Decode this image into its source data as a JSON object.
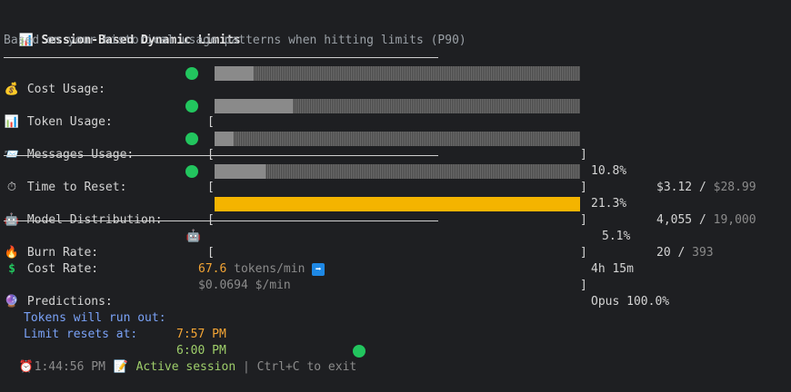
{
  "header": {
    "title_icon": "bar-chart-icon",
    "title": "Session-Based Dynamic Limits",
    "subtitle": "Based on your historical usage patterns when hitting limits (P90)"
  },
  "metrics": [
    {
      "icon": "money-bag-icon",
      "label": "Cost Usage:",
      "status": "green",
      "fill": 0.108,
      "percent": "10.8%",
      "value": "$3.12",
      "sep": " / ",
      "limit": "$28.99"
    },
    {
      "icon": "bar-chart-icon",
      "label": "Token Usage:",
      "status": "green",
      "fill": 0.213,
      "percent": "21.3%",
      "value": "4,055",
      "sep": " / ",
      "limit": "19,000"
    },
    {
      "icon": "inbox-icon",
      "label": "Messages Usage:",
      "status": "green",
      "fill": 0.051,
      "percent": "5.1%",
      "value": "20",
      "sep": " / ",
      "limit": "393"
    },
    {
      "icon": "stopwatch-icon",
      "label": "Time to Reset:",
      "status": "green",
      "fill": 0.14,
      "percent": "4h 15m",
      "value": "",
      "sep": "",
      "limit": ""
    }
  ],
  "distribution": {
    "icon": "robot-icon",
    "label": "Model Distribution:",
    "fill": 1.0,
    "text": "Opus 100.0%"
  },
  "rates": {
    "burn_label": "Burn Rate:",
    "burn_value": "67.6",
    "burn_unit": " tokens/min ",
    "burn_trend_icon": "arrow-right-icon",
    "cost_label": "Cost Rate:",
    "cost_value": "$0.0694 $/min"
  },
  "predictions": {
    "title": "Predictions:",
    "tokens_label": "Tokens will run out:",
    "tokens_value": "7:57 PM",
    "reset_label": "Limit resets at:",
    "reset_value": "6:00 PM"
  },
  "footer": {
    "time": "1:44:56 PM",
    "session": "Active session",
    "divider": " | ",
    "hint": "Ctrl+C to exit"
  },
  "colors": {
    "accent_green": "#22c55e",
    "bar_gold": "#f4b400",
    "orange": "#f4a535",
    "blue": "#7aa2f7"
  }
}
